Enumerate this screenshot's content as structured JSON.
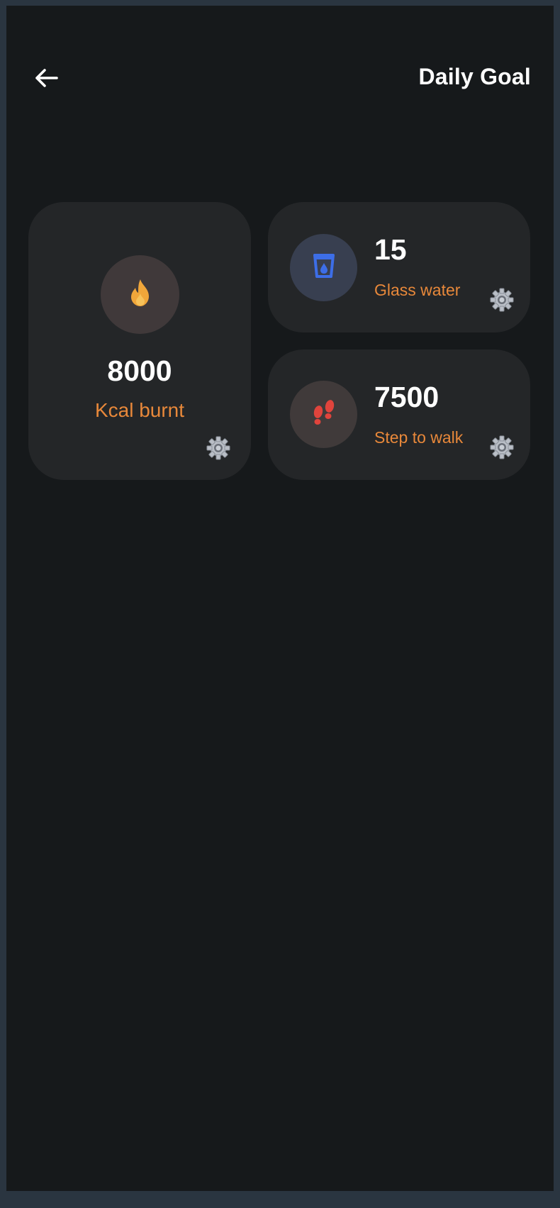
{
  "header": {
    "title": "Daily Goal",
    "back_icon": "arrow-left-icon"
  },
  "goals": {
    "kcal": {
      "value": "8000",
      "label": "Kcal burnt",
      "icon": "fire-icon",
      "accent": "#f0a63a"
    },
    "water": {
      "value": "15",
      "label": "Glass water",
      "icon": "water-glass-icon",
      "accent": "#3d6ee8"
    },
    "steps": {
      "value": "7500",
      "label": "Step to walk",
      "icon": "footsteps-icon",
      "accent": "#e0443c"
    }
  },
  "colors": {
    "background": "#16191b",
    "card": "#242628",
    "label_accent": "#e8883a",
    "value_text": "#ffffff"
  }
}
